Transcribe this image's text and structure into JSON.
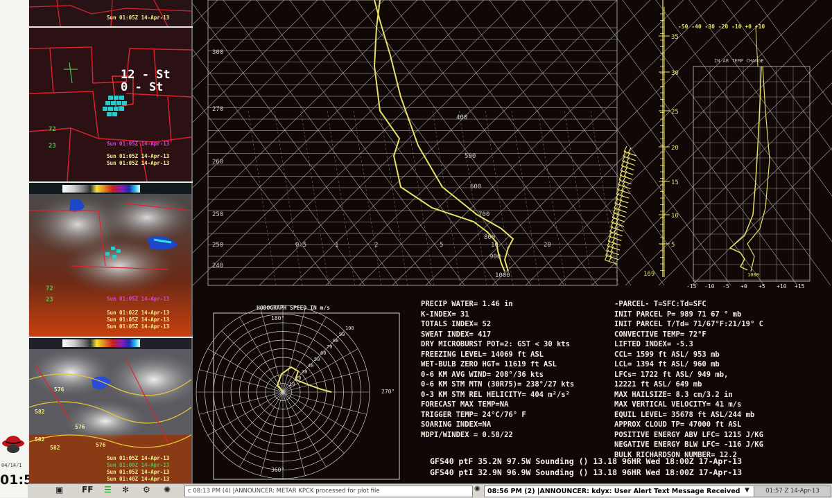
{
  "desktop": {
    "clock": "01:5",
    "date": "04/14/1"
  },
  "thumbnails": {
    "t1": {
      "caption": "Sun 01:05Z 14-Apr-13"
    },
    "t2": {
      "overlay_line1": "12 - St",
      "overlay_line2": "0 - St",
      "station": "72",
      "station2": "23",
      "captions": [
        "Sun 01:05Z 14-Apr-13",
        "Sun 01:05Z 14-Apr-13",
        "Sun 01:05Z 14-Apr-13"
      ]
    },
    "t3": {
      "station": "72",
      "station2": "23",
      "captions": [
        "Sun 01:05Z 14-Apr-13",
        "Sun 01:02Z 14-Apr-13",
        "Sun 01:05Z 14-Apr-13",
        "Sun 01:05Z 14-Apr-13"
      ]
    },
    "t4": {
      "labels": [
        "576",
        "582",
        "576",
        "582",
        "582",
        "576"
      ],
      "captions": [
        "Sun 01:05Z 14-Apr-13",
        "Sun 01:00Z 14-Apr-13",
        "Sun 01:05Z 14-Apr-13",
        "Sun 01:40Z 14-Apr-13"
      ]
    }
  },
  "skewt": {
    "pressure_labels": [
      "400",
      "500",
      "600",
      "700",
      "800",
      "900",
      "1000"
    ],
    "mixing_ratio_labels": [
      "0.5",
      "1",
      "2",
      "5",
      "10",
      "20"
    ],
    "theta_labels": [
      "300",
      "270",
      "260",
      "250",
      "250",
      "240"
    ],
    "height_labels": [
      "169"
    ],
    "wind_scale": [
      "35",
      "30",
      "25",
      "20",
      "15",
      "10",
      "5"
    ]
  },
  "lapse": {
    "top_axis": "-50 -40 -30 -20 -10 +0 +10",
    "title": "IN AR TEMP CHANGE",
    "bottom_axis": [
      "-15",
      "-10",
      "-5",
      "+0",
      "+5",
      "+10",
      "+15"
    ],
    "center_label": "1000"
  },
  "hodograph": {
    "title": "HODOGRAPH SPEED IN m/s",
    "dir_labels": {
      "north": "180°",
      "east": "270°",
      "south": "360°"
    },
    "ring_labels": [
      "10",
      "20",
      "30",
      "40",
      "50",
      "60",
      "70",
      "80",
      "90",
      "100"
    ]
  },
  "indices_left": [
    "PRECIP WATER= 1.46 in",
    "K-INDEX= 31",
    "TOTALS INDEX= 52",
    "SWEAT INDEX= 417",
    "DRY MICROBURST POT=2: GST < 30 kts",
    "FREEZING LEVEL= 14069 ft ASL",
    "WET-BULB ZERO HGT= 11619 ft ASL",
    "0-6 KM AVG WIND= 208°/36 kts",
    "0-6 KM STM MTN (30R75)= 238°/27 kts",
    "0-3 KM STM REL HELICITY= 404 m²/s²",
    "FORECAST MAX TEMP=NA",
    "TRIGGER TEMP= 24°C/76° F",
    "SOARING INDEX=NA",
    "MDPI/WINDEX = 0.58/22"
  ],
  "indices_right": [
    "-PARCEL- T=SFC:Td=SFC",
    "INIT PARCEL P= 989 71 67 ° mb",
    "INIT PARCEL T/Td= 71/67°F:21/19° C",
    "CONVECTIVE TEMP= 72°F",
    "LIFTED INDEX= -5.3",
    "CCL= 1599 ft ASL/ 953 mb",
    "LCL= 1394 ft ASL/ 960 mb",
    "LFCs= 1722 ft ASL/ 949 mb,",
    "12221 ft ASL/ 649 mb",
    "MAX HAILSIZE= 8.3 cm/3.2 in",
    "MAX VERTICAL VELOCITY= 41 m/s",
    "EQUIL LEVEL= 35678 ft ASL/244 mb",
    "APPROX CLOUD TP= 47000 ft ASL",
    "POSITIVE ENERGY ABV LFC= 1215 J/KG",
    "NEGATIVE ENERGY BLW LFC= -116 J/KG",
    "BULK RICHARDSON NUMBER= 12.2"
  ],
  "soundings": [
    "GFS40 ptF 35.2N 97.5W Sounding () 13.18 96HR Wed 18:00Z 17-Apr-13",
    "GFS40 ptI 32.9N 96.9W Sounding () 13.18 96HR Wed 18:00Z 17-Apr-13"
  ],
  "statusbar": {
    "msg1": "c 08:13 PM (4) |ANNOUNCER: METAR KPCK processed for plot file",
    "msg2": "08:56 PM (2) |ANNOUNCER: kdyx: User Alert Text Message Received",
    "tray": "01:57 Z 14-Apr-13",
    "icon_ff": "FF"
  }
}
